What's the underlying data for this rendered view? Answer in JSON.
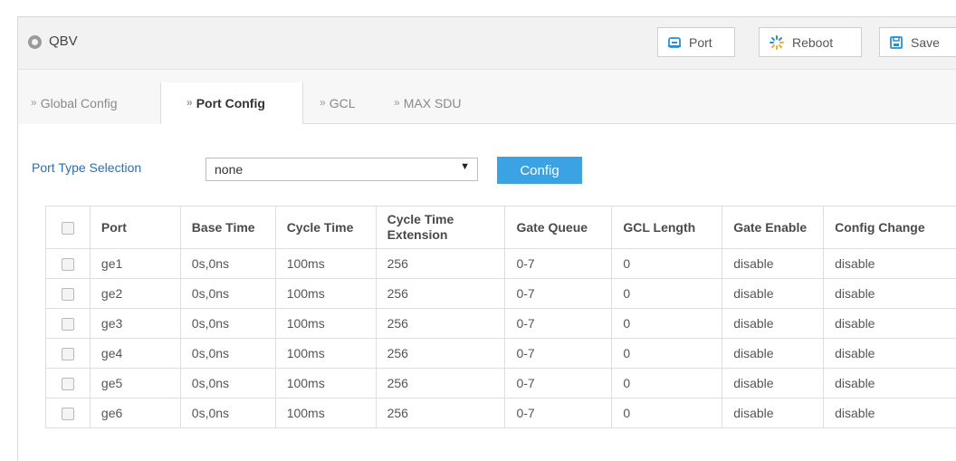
{
  "header": {
    "title": "QBV",
    "buttons": {
      "port": "Port",
      "reboot": "Reboot",
      "save": "Save"
    }
  },
  "tabs": [
    {
      "label": "Global Config",
      "active": false
    },
    {
      "label": "Port Config",
      "active": true
    },
    {
      "label": "GCL",
      "active": false
    },
    {
      "label": "MAX SDU",
      "active": false
    }
  ],
  "port_type": {
    "label": "Port Type Selection",
    "selected": "none",
    "config_button": "Config"
  },
  "table": {
    "headers": {
      "port": "Port",
      "base_time": "Base Time",
      "cycle_time": "Cycle Time",
      "cycle_time_ext": "Cycle Time Extension",
      "gate_queue": "Gate Queue",
      "gcl_length": "GCL Length",
      "gate_enable": "Gate Enable",
      "config_change": "Config Change"
    },
    "rows": [
      {
        "port": "ge1",
        "base_time": "0s,0ns",
        "cycle_time": "100ms",
        "cycle_time_ext": "256",
        "gate_queue": "0-7",
        "gcl_length": "0",
        "gate_enable": "disable",
        "config_change": "disable"
      },
      {
        "port": "ge2",
        "base_time": "0s,0ns",
        "cycle_time": "100ms",
        "cycle_time_ext": "256",
        "gate_queue": "0-7",
        "gcl_length": "0",
        "gate_enable": "disable",
        "config_change": "disable"
      },
      {
        "port": "ge3",
        "base_time": "0s,0ns",
        "cycle_time": "100ms",
        "cycle_time_ext": "256",
        "gate_queue": "0-7",
        "gcl_length": "0",
        "gate_enable": "disable",
        "config_change": "disable"
      },
      {
        "port": "ge4",
        "base_time": "0s,0ns",
        "cycle_time": "100ms",
        "cycle_time_ext": "256",
        "gate_queue": "0-7",
        "gcl_length": "0",
        "gate_enable": "disable",
        "config_change": "disable"
      },
      {
        "port": "ge5",
        "base_time": "0s,0ns",
        "cycle_time": "100ms",
        "cycle_time_ext": "256",
        "gate_queue": "0-7",
        "gcl_length": "0",
        "gate_enable": "disable",
        "config_change": "disable"
      },
      {
        "port": "ge6",
        "base_time": "0s,0ns",
        "cycle_time": "100ms",
        "cycle_time_ext": "256",
        "gate_queue": "0-7",
        "gcl_length": "0",
        "gate_enable": "disable",
        "config_change": "disable"
      }
    ]
  },
  "colors": {
    "accent": "#3ba3e4",
    "link": "#2a6fb0",
    "icon_blue": "#2b8fd6"
  },
  "icons": {
    "header": "circle-icon",
    "port": "port-icon",
    "reboot": "reboot-icon",
    "save": "save-icon",
    "tab_arrow": "double-chevron-right-icon"
  }
}
